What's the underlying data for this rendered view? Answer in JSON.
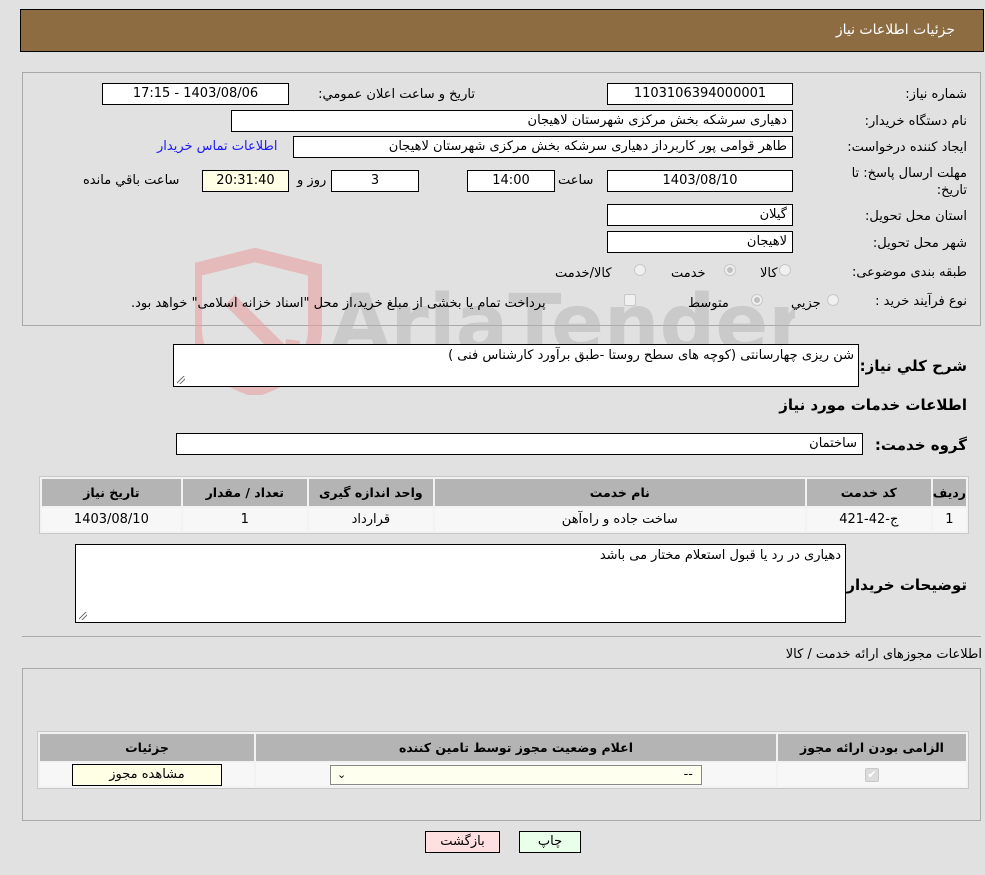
{
  "header": {
    "title": "جزئیات اطلاعات نیاز"
  },
  "form": {
    "need_number": {
      "label": "شماره نیاز:",
      "value": "1103106394000001"
    },
    "announce_datetime": {
      "label": "تاريخ و ساعت اعلان عمومي:",
      "value": "1403/08/06 - 17:15"
    },
    "buyer_org": {
      "label": "نام دستگاه خریدار:",
      "value": "دهیاری سرشکه بخش مرکزی شهرستان لاهیجان"
    },
    "requester": {
      "label": "ایجاد کننده درخواست:",
      "value": "طاهر قوامی پور کاربرداز دهیاری سرشکه بخش مرکزی شهرستان لاهیجان"
    },
    "buyer_contact_link": "اطلاعات تماس خریدار",
    "deadline": {
      "label_line1": "مهلت ارسال پاسخ: تا",
      "label_line2": "تاریخ:",
      "date": "1403/08/10",
      "time_label": "ساعت",
      "time": "14:00",
      "days": "3",
      "days_label": "روز و",
      "remaining": "20:31:40",
      "remaining_label": "ساعت باقي مانده"
    },
    "province": {
      "label": "استان محل تحویل:",
      "value": "گیلان"
    },
    "city": {
      "label": "شهر محل تحویل:",
      "value": "لاهیجان"
    },
    "category": {
      "label": "طبقه بندی موضوعی:",
      "options": [
        "کالا",
        "خدمت",
        "کالا/خدمت"
      ],
      "selected": "خدمت"
    },
    "purchase_process": {
      "label": "نوع فرآیند خرید :",
      "options": [
        "جزيي",
        "متوسط"
      ],
      "selected": "متوسط",
      "treasury_note": "پرداخت تمام یا بخشی از مبلغ خرید،از محل \"اسناد خزانه اسلامی\" خواهد بود."
    }
  },
  "description": {
    "label": "شرح كلي نياز:",
    "value": "شن ریزی چهارسانتی (کوچه های  سطح روستا -طبق برآورد کارشناس فنی )"
  },
  "services_section": {
    "title": "اطلاعات خدمات مورد نیاز",
    "service_group": {
      "label": "گروه خدمت:",
      "value": "ساختمان"
    },
    "table": {
      "headers": [
        "ردیف",
        "کد خدمت",
        "نام خدمت",
        "واحد اندازه گیری",
        "تعداد / مقدار",
        "تاریخ نیاز"
      ],
      "rows": [
        [
          "1",
          "ج-42-421",
          "ساخت جاده و راه‌آهن",
          "قرارداد",
          "1",
          "1403/08/10"
        ]
      ]
    }
  },
  "buyer_notes": {
    "label": "توضیحات خریدار:",
    "value": "دهیاری در رد یا قبول استعلام مختار می باشد"
  },
  "licenses": {
    "title": "اطلاعات مجوزهای ارائه خدمت / کالا",
    "headers": [
      "الزامی بودن ارائه مجوز",
      "اعلام وضعیت مجوز توسط تامین کننده",
      "جزئیات"
    ],
    "rows": [
      {
        "required_checked": true,
        "status_select": "--",
        "details_button": "مشاهده مجوز"
      }
    ]
  },
  "footer": {
    "print_button": "چاپ",
    "back_button": "بازگشت"
  },
  "watermark": {
    "text": "AriaTender.neT"
  },
  "colors": {
    "header_bg": "#8d6c42",
    "print_bg": "#eaffea",
    "back_bg": "#ffe0e0",
    "link": "#1a1aff"
  }
}
